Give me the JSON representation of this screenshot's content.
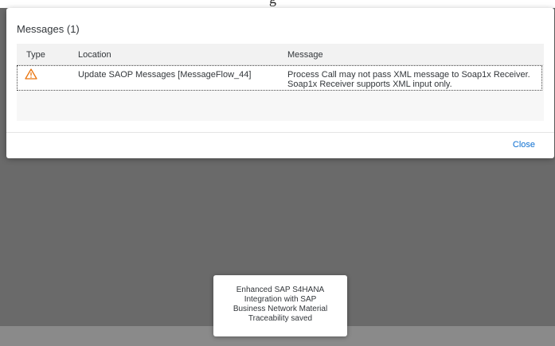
{
  "page_title_fragment": "g",
  "dialog": {
    "title": "Messages (1)",
    "columns": {
      "type": "Type",
      "location": "Location",
      "message": "Message"
    },
    "rows": [
      {
        "type_icon": "warning-icon",
        "location": "Update SAOP Messages [MessageFlow_44]",
        "message_line1": "Process Call may not pass XML message to Soap1x Receiver.",
        "message_line2": "Soap1x Receiver supports XML input only."
      }
    ],
    "close_label": "Close"
  },
  "toast": {
    "lines": [
      "Enhanced SAP S4HANA",
      "Integration with SAP",
      "Business Network Material",
      "Traceability saved"
    ]
  },
  "colors": {
    "backdrop": "#6a6a6a",
    "link": "#0a6ed1",
    "warning": "#e9730c",
    "text": "#32363a"
  }
}
